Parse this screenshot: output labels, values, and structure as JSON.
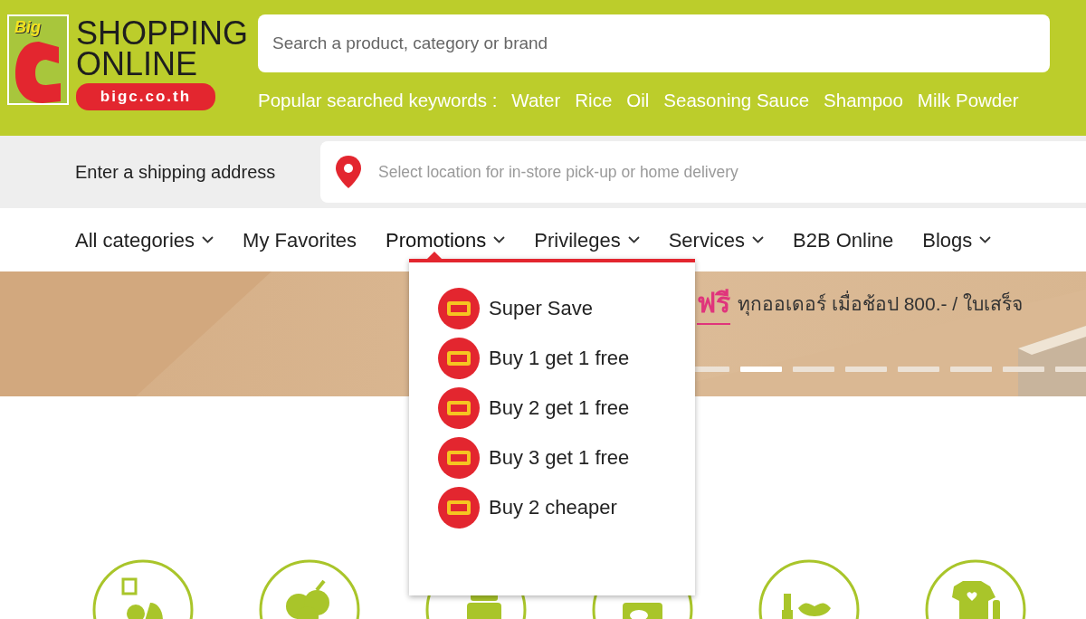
{
  "logo": {
    "badge": "Big",
    "title_1": "SHOPPING",
    "title_2": "ONLINE",
    "domain": "bigc.co.th"
  },
  "search": {
    "placeholder": "Search a product, category or brand"
  },
  "popular": {
    "label": "Popular searched keywords :",
    "keywords": [
      "Water",
      "Rice",
      "Oil",
      "Seasoning Sauce",
      "Shampoo",
      "Milk Powder"
    ]
  },
  "shipping": {
    "label": "Enter a shipping address",
    "placeholder": "Select location for in-store pick-up or home delivery"
  },
  "nav": [
    {
      "label": "All categories",
      "dropdown": true,
      "selected": false
    },
    {
      "label": "My Favorites",
      "dropdown": false,
      "selected": false
    },
    {
      "label": "Promotions",
      "dropdown": true,
      "selected": true
    },
    {
      "label": "Privileges",
      "dropdown": true,
      "selected": false
    },
    {
      "label": "Services",
      "dropdown": true,
      "selected": false
    },
    {
      "label": "B2B Online",
      "dropdown": false,
      "selected": false
    },
    {
      "label": "Blogs",
      "dropdown": true,
      "selected": false
    }
  ],
  "promotions_menu": [
    {
      "label": "Super Save"
    },
    {
      "label": "Buy 1 get 1 free"
    },
    {
      "label": "Buy 2 get 1 free"
    },
    {
      "label": "Buy 3 get 1 free"
    },
    {
      "label": "Buy 2 cheaper"
    }
  ],
  "banner": {
    "highlight": "ฟรี",
    "text": "ทุกออเดอร์ เมื่อช้อป 800.- / ใบเสร็จ",
    "slides": [
      {
        "selected": false
      },
      {
        "selected": true
      },
      {
        "selected": false
      },
      {
        "selected": false
      },
      {
        "selected": false
      },
      {
        "selected": false
      },
      {
        "selected": false
      },
      {
        "selected": false
      }
    ]
  }
}
